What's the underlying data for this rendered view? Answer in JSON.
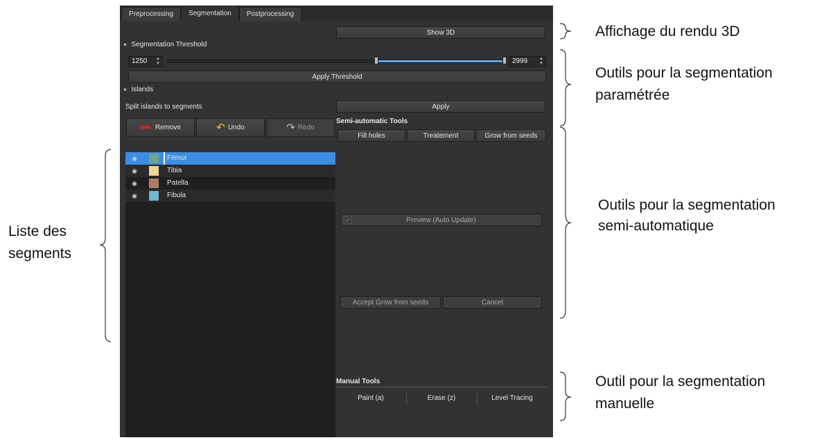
{
  "tabs": [
    "Preprocessing",
    "Segmentation",
    "Postprocessing"
  ],
  "show3d_label": "Show 3D",
  "threshold": {
    "section_label": "Segmentation Threshold",
    "min_value": "1250",
    "max_value": "2999",
    "range_start_fraction": 0.617,
    "range_end_fraction": 1.0,
    "apply_label": "Apply Threshold"
  },
  "islands": {
    "section_label": "Islands",
    "split_label": "Split islands to segments",
    "apply_label": "Apply"
  },
  "segment_toolbar": {
    "remove_label": "Remove",
    "undo_label": "Undo",
    "redo_label": "Redo"
  },
  "segments": [
    {
      "name": "Fémur",
      "color": "#6fa58e",
      "selected": true
    },
    {
      "name": "Tibia",
      "color": "#f1d691",
      "selected": false
    },
    {
      "name": "Patella",
      "color": "#b17a65",
      "selected": false
    },
    {
      "name": "Fibula",
      "color": "#6fb8d2",
      "selected": false
    }
  ],
  "semi_auto": {
    "title": "Semi-automatic Tools",
    "tools": [
      "Fill holes",
      "Treatement",
      "Grow from seeds"
    ],
    "preview_label": "Preview (Auto Update)",
    "accept_label": "Accept Grow from seeds",
    "cancel_label": "Cancel"
  },
  "manual": {
    "title": "Manual Tools",
    "tools": [
      "Paint (a)",
      "Erase (z)",
      "Level Tracing"
    ]
  },
  "annotations": {
    "rendu3d": "Affichage du rendu 3D",
    "param_line1": "Outils pour la segmentation",
    "param_line2": "paramétrée",
    "semi_line1": "Outils pour la segmentation",
    "semi_line2": "semi-automatique",
    "list_line1": "Liste des",
    "list_line2": "segments",
    "manual_line1": "Outil pour la segmentation",
    "manual_line2": "manuelle"
  },
  "colors": {
    "panel_bg": "#323232",
    "selection": "#3a8ee6",
    "slider_fill": "#5fa8f0",
    "remove_red": "#d02020",
    "undo_yellow": "#f0c030"
  }
}
